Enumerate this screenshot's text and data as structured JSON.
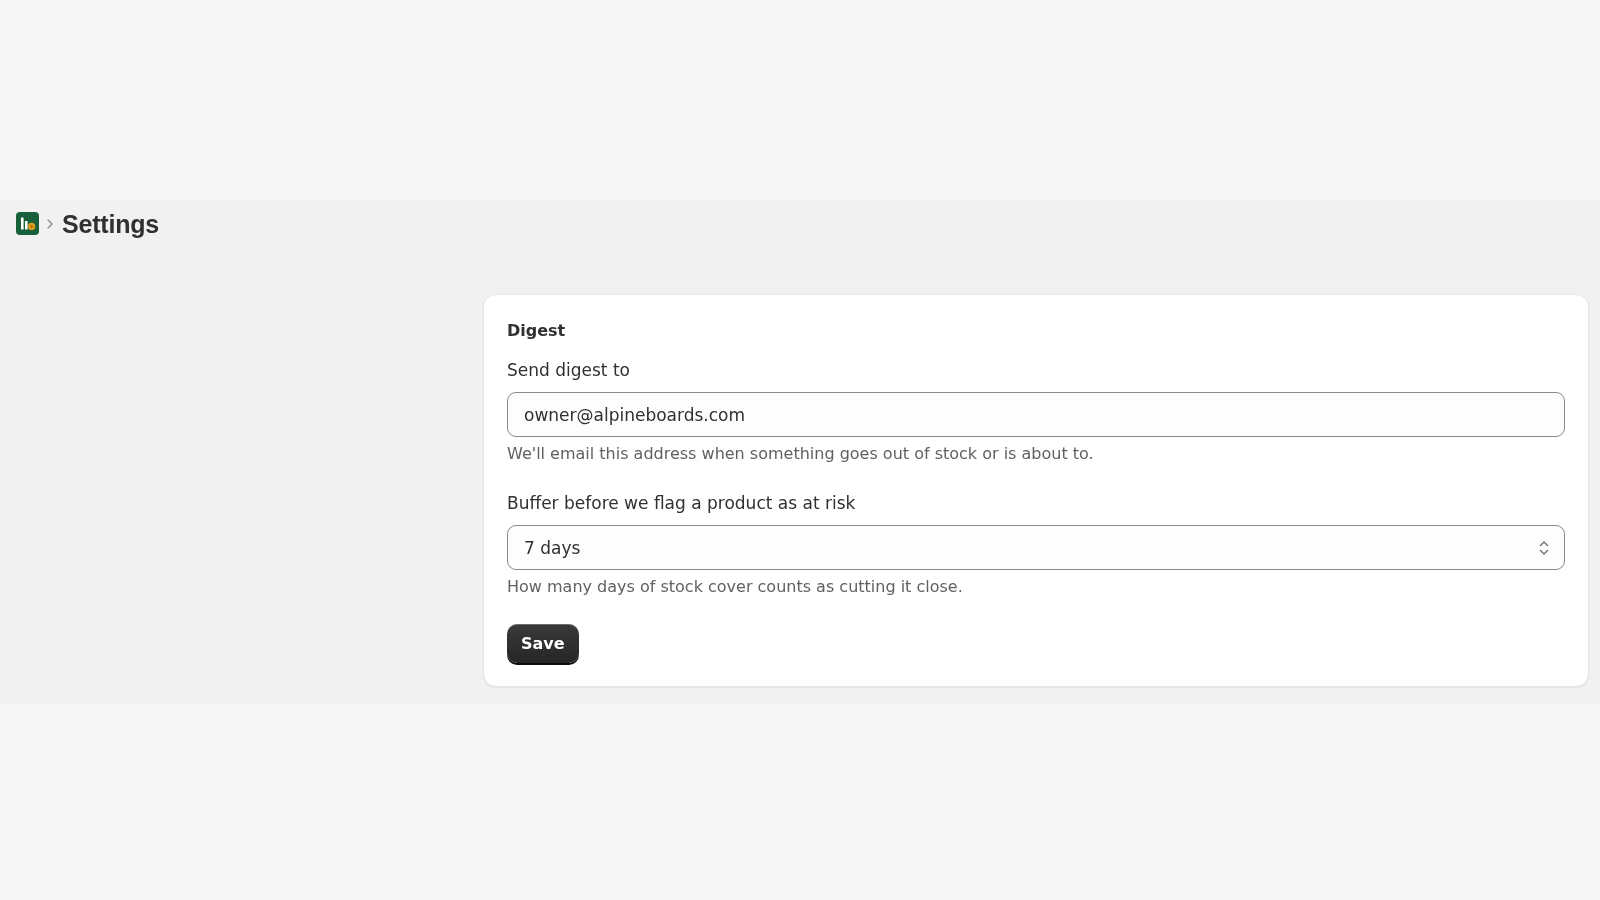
{
  "header": {
    "title": "Settings"
  },
  "card": {
    "title": "Digest",
    "fields": [
      {
        "kind": "text",
        "label": "Send digest to",
        "value": "owner@alpineboards.com",
        "help": "We'll email this address when something goes out of stock or is about to."
      },
      {
        "kind": "select",
        "label": "Buffer before we flag a product as at risk",
        "value": "7 days",
        "help": "How many days of stock cover counts as cutting it close."
      }
    ],
    "button": "Save"
  }
}
